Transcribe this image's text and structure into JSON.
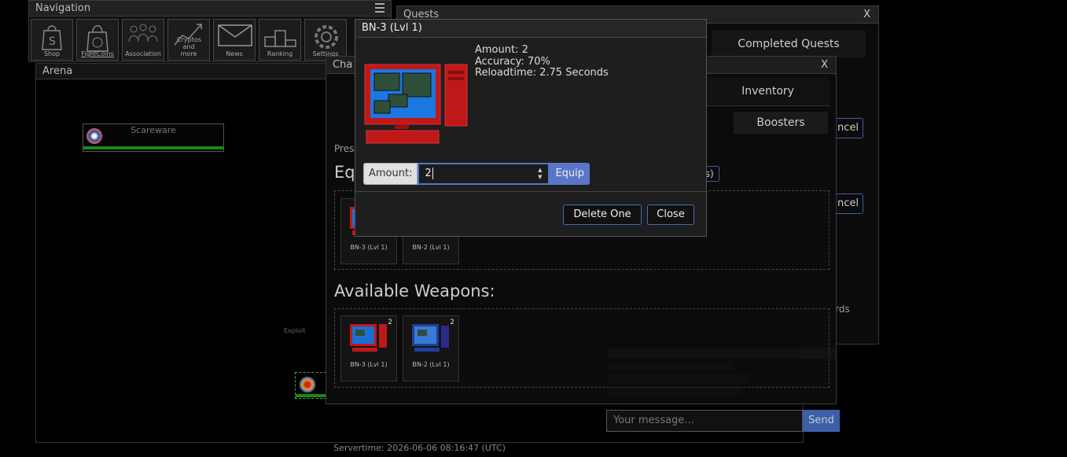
{
  "navigation": {
    "title": "Navigation",
    "items": [
      {
        "label": "Shop",
        "icon": "shopping-bag-icon"
      },
      {
        "label": "FightCoins",
        "icon": "coin-bag-icon"
      },
      {
        "label": "Association",
        "icon": "people-icon"
      },
      {
        "label": "Cryptos and more",
        "icon": "chart-icon"
      },
      {
        "label": "News",
        "icon": "envelope-icon"
      },
      {
        "label": "Ranking",
        "icon": "podium-icon"
      },
      {
        "label": "Settings",
        "icon": "gear-icon"
      }
    ]
  },
  "arena": {
    "title": "Arena",
    "enemy_name": "Scareware",
    "exploit_label": "Exploit",
    "servertime": "Servertime: 2026-06-06 08:16:47 (UTC)"
  },
  "quests": {
    "title": "Quests",
    "close": "X",
    "tab_completed": "Completed Quests",
    "cancel_1": "Cancel",
    "cancel_2": "Cancel",
    "credits_text": "redits)",
    "rewards_text": "wards"
  },
  "character": {
    "title": "Cha",
    "close": "X",
    "tab_inventory": "Inventory",
    "tab_boosters": "Boosters",
    "press_text": "Pres",
    "equipped_heading": "Eq",
    "available_heading": "Available Weapons:",
    "equipped": [
      {
        "name": "BN-3 (Lvl 1)"
      },
      {
        "name": "BN-2 (Lvl 1)"
      }
    ],
    "available": [
      {
        "name": "BN-3 (Lvl 1)",
        "count": "2"
      },
      {
        "name": "BN-2 (Lvl 1)",
        "count": "2"
      }
    ]
  },
  "chat": {
    "placeholder": "Your message...",
    "send": "Send"
  },
  "modal": {
    "title": "BN-3 (Lvl 1)",
    "amount_line": "Amount: 2",
    "accuracy_line": "Accuracy: 70%",
    "reload_line": "Reloadtime: 2.75 Seconds",
    "amount_label": "Amount:",
    "amount_value": "2",
    "equip": "Equip",
    "delete_one": "Delete One",
    "close": "Close"
  },
  "colors": {
    "accent": "#3c5fa8",
    "equip": "#5b76c8",
    "hp": "#1a8a1a"
  }
}
